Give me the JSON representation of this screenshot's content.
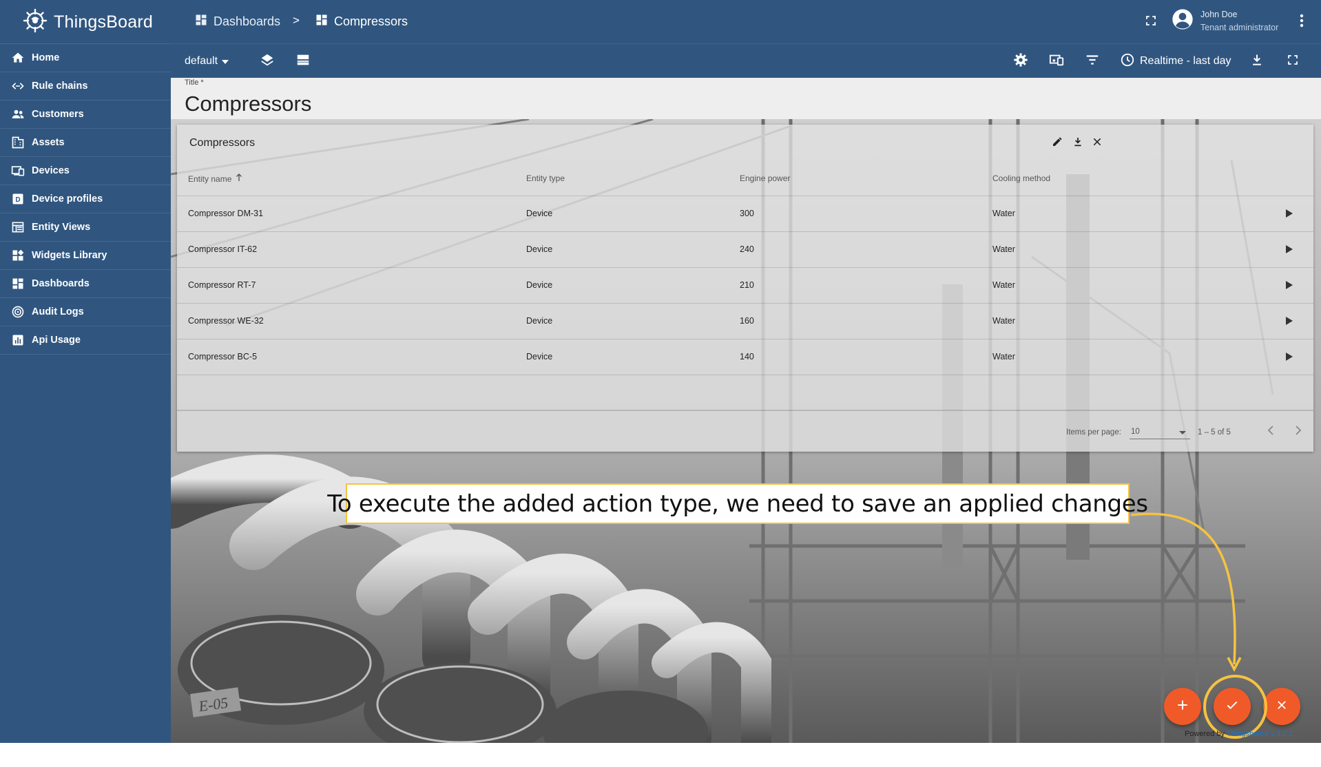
{
  "app": {
    "name": "ThingsBoard"
  },
  "sidebar": {
    "items": [
      {
        "label": "Home",
        "icon": "home-icon"
      },
      {
        "label": "Rule chains",
        "icon": "rule-chains-icon"
      },
      {
        "label": "Customers",
        "icon": "customers-icon"
      },
      {
        "label": "Assets",
        "icon": "assets-icon"
      },
      {
        "label": "Devices",
        "icon": "devices-icon"
      },
      {
        "label": "Device profiles",
        "icon": "device-profiles-icon"
      },
      {
        "label": "Entity Views",
        "icon": "entity-views-icon"
      },
      {
        "label": "Widgets Library",
        "icon": "widgets-library-icon"
      },
      {
        "label": "Dashboards",
        "icon": "dashboards-icon"
      },
      {
        "label": "Audit Logs",
        "icon": "audit-logs-icon"
      },
      {
        "label": "Api Usage",
        "icon": "api-usage-icon"
      }
    ]
  },
  "header": {
    "breadcrumb": [
      {
        "label": "Dashboards",
        "icon": "dashboards-icon"
      },
      {
        "label": "Compressors",
        "icon": "dashboard-icon"
      }
    ],
    "breadcrumb_separator": ">",
    "user": {
      "name": "John Doe",
      "role": "Tenant administrator"
    }
  },
  "toolbar": {
    "state": "default",
    "timewindow": "Realtime - last day"
  },
  "title_field": {
    "label": "Title *",
    "value": "Compressors"
  },
  "widget": {
    "title": "Compressors",
    "columns": [
      "Entity name",
      "Entity type",
      "Engine power",
      "Cooling method"
    ],
    "sort_column": "Entity name",
    "sort_direction": "ascending",
    "rows": [
      {
        "name": "Compressor DM-31",
        "type": "Device",
        "power": "300",
        "cooling": "Water"
      },
      {
        "name": "Compressor IT-62",
        "type": "Device",
        "power": "240",
        "cooling": "Water"
      },
      {
        "name": "Compressor RT-7",
        "type": "Device",
        "power": "210",
        "cooling": "Water"
      },
      {
        "name": "Compressor WE-32",
        "type": "Device",
        "power": "160",
        "cooling": "Water"
      },
      {
        "name": "Compressor BC-5",
        "type": "Device",
        "power": "140",
        "cooling": "Water"
      }
    ],
    "pagination": {
      "items_per_page_label": "Items per page:",
      "items_per_page": "10",
      "range": "1 – 5 of 5"
    }
  },
  "tooltip": {
    "text": "To execute the added action type, we need to save an applied changes"
  },
  "footer": {
    "powered_prefix": "Powered by ",
    "powered_link": "Thingsboard v.3.2.1"
  },
  "colors": {
    "primary": "#305680",
    "fab": "#f05a28",
    "highlight": "#f5c242"
  }
}
